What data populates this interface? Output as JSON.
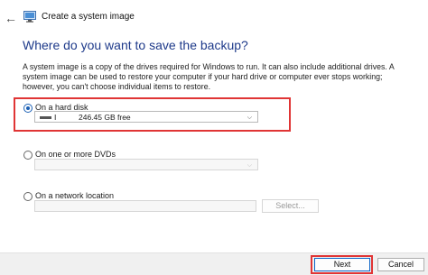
{
  "window": {
    "title": "Create a system image",
    "back_icon": "back-arrow-icon",
    "app_icon": "system-image-icon"
  },
  "page": {
    "heading": "Where do you want to save the backup?",
    "description": "A system image is a copy of the drives required for Windows to run. It can also include additional drives. A system image can be used to restore your computer if your hard drive or computer ever stops working; however, you can't choose individual items to restore."
  },
  "options": {
    "hard_disk": {
      "label": "On a hard disk",
      "selected": true,
      "drive_letter": "I",
      "drive_free": "246.45 GB free"
    },
    "dvds": {
      "label": "On one or more DVDs",
      "selected": false
    },
    "network": {
      "label": "On a network location",
      "selected": false,
      "path_value": "",
      "select_button": "Select..."
    }
  },
  "footer": {
    "next": "Next",
    "cancel": "Cancel"
  },
  "colors": {
    "heading": "#1e3a8a",
    "highlight": "#e03535",
    "accent": "#1a5fb4"
  }
}
